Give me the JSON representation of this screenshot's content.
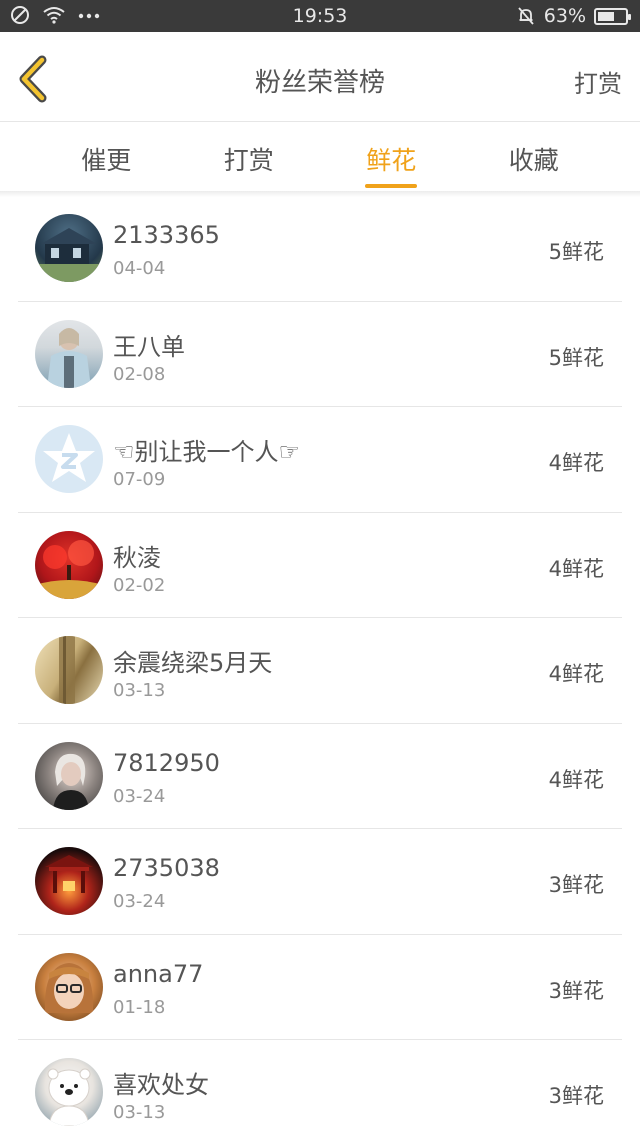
{
  "status_bar": {
    "time": "19:53",
    "battery_percent": "63%",
    "battery_level": 0.63,
    "left_icons": [
      "do-not-disturb-icon",
      "wifi-icon",
      "more-dots-icon"
    ],
    "right_icons": [
      "bell-muted-icon",
      "battery-icon"
    ]
  },
  "header": {
    "title": "粉丝荣誉榜",
    "action_label": "打赏",
    "back_icon": "chevron-left-icon"
  },
  "tabs": [
    {
      "label": "催更",
      "active": false
    },
    {
      "label": "打赏",
      "active": false
    },
    {
      "label": "鲜花",
      "active": true
    },
    {
      "label": "收藏",
      "active": false
    }
  ],
  "colors": {
    "accent": "#f0a21a",
    "status_bar_bg": "#3a3a3a",
    "text": "#555555",
    "subtext": "#999999",
    "divider": "#e6e6e6"
  },
  "fans": [
    {
      "name": "2133365",
      "date": "04-04",
      "count": "5鲜花"
    },
    {
      "name": "王八单",
      "date": "02-08",
      "count": "5鲜花"
    },
    {
      "name": "☜别让我一个人☞",
      "date": "07-09",
      "count": "4鲜花"
    },
    {
      "name": "秋淩",
      "date": "02-02",
      "count": "4鲜花"
    },
    {
      "name": "余震绕梁5月天",
      "date": "03-13",
      "count": "4鲜花"
    },
    {
      "name": "7812950",
      "date": "03-24",
      "count": "4鲜花"
    },
    {
      "name": "2735038",
      "date": "03-24",
      "count": "3鲜花"
    },
    {
      "name": "anna77",
      "date": "01-18",
      "count": "3鲜花"
    },
    {
      "name": "喜欢处女",
      "date": "03-13",
      "count": "3鲜花"
    }
  ]
}
